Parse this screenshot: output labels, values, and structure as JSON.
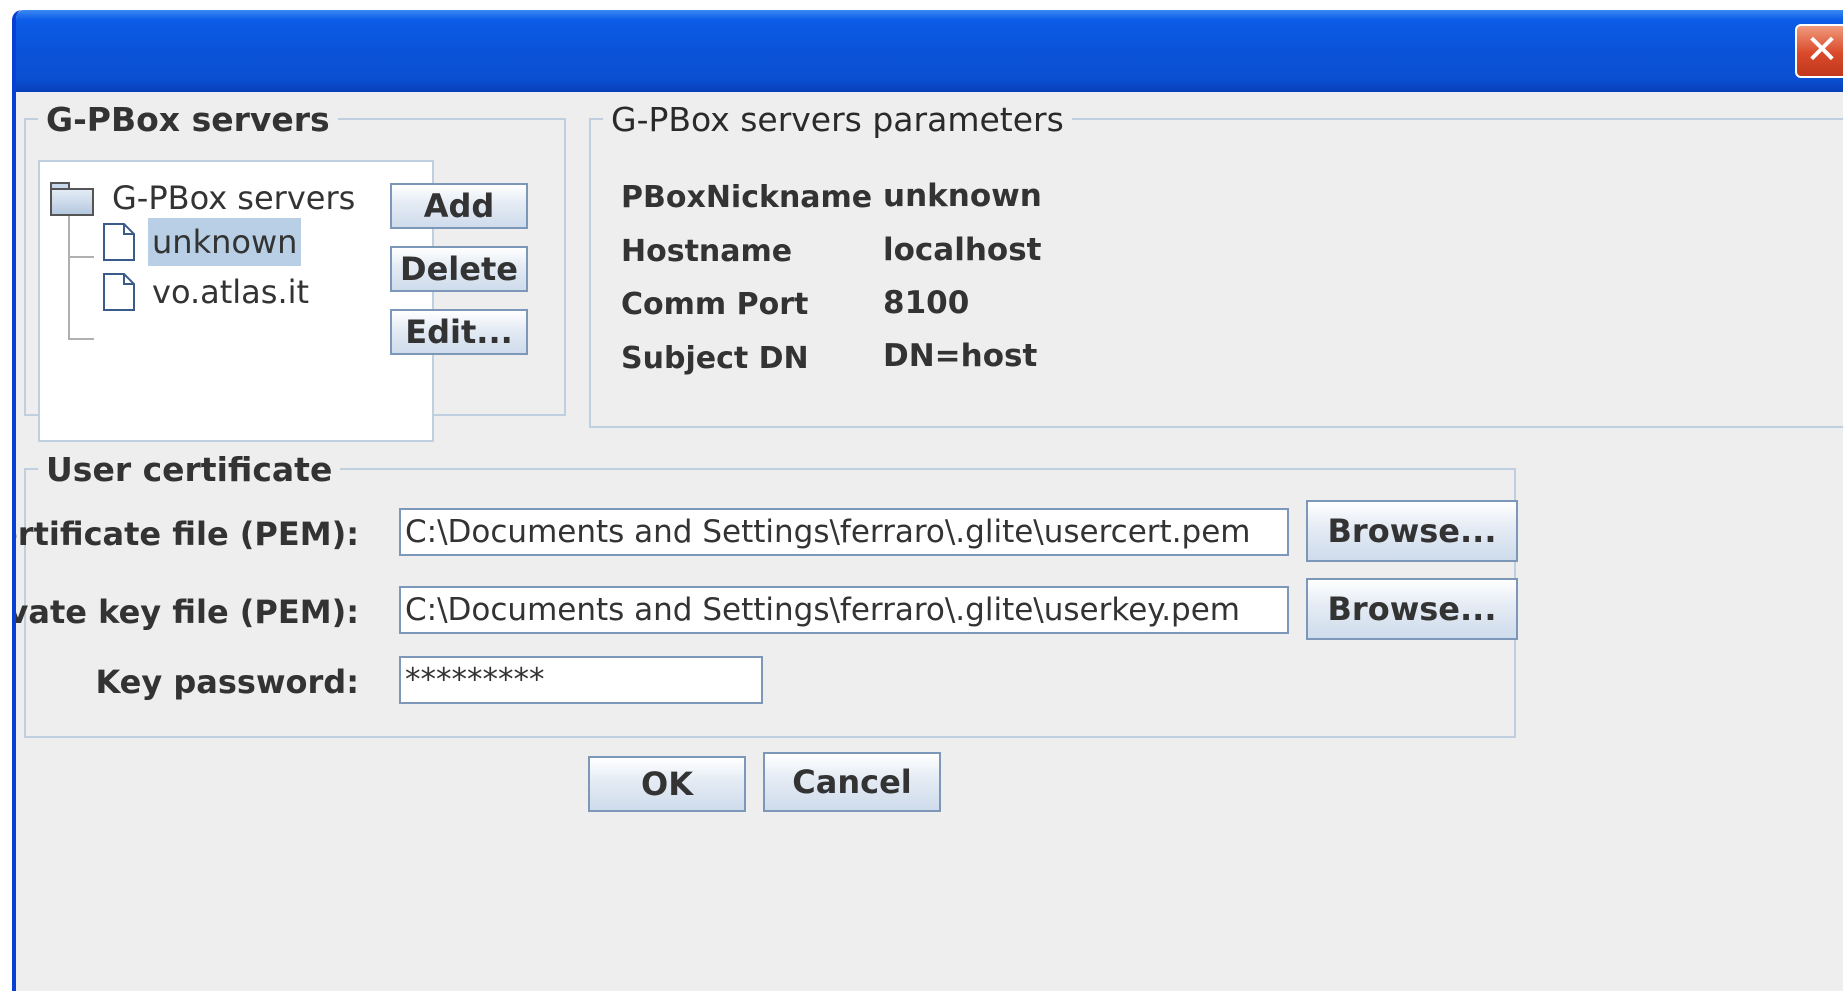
{
  "window": {
    "close_symbol": "✕"
  },
  "servers_panel": {
    "legend": "G-PBox servers",
    "tree": {
      "root_label": "G-PBox servers",
      "items": [
        {
          "label": "unknown",
          "selected": true
        },
        {
          "label": "vo.atlas.it",
          "selected": false
        }
      ]
    },
    "buttons": {
      "add": "Add",
      "delete": "Delete",
      "edit": "Edit..."
    }
  },
  "params_panel": {
    "legend": "G-PBox servers parameters",
    "rows": [
      {
        "label": "PBoxNickname",
        "value": "unknown"
      },
      {
        "label": "Hostname",
        "value": "localhost"
      },
      {
        "label": "Comm Port",
        "value": "8100"
      },
      {
        "label": "Subject DN",
        "value": "DN=host"
      }
    ]
  },
  "certificate_panel": {
    "legend": "User certificate",
    "certificate_file": {
      "label": "Certificate file (PEM):",
      "value": "C:\\Documents and Settings\\ferraro\\.glite\\usercert.pem",
      "browse_label": "Browse..."
    },
    "private_key_file": {
      "label": "Private key file (PEM):",
      "value": "C:\\Documents and Settings\\ferraro\\.glite\\userkey.pem",
      "browse_label": "Browse..."
    },
    "key_password": {
      "label": "Key password:",
      "value": "*********"
    }
  },
  "footer": {
    "ok": "OK",
    "cancel": "Cancel"
  },
  "colors": {
    "titlebar": "#0a53d8",
    "window_bg": "#eeeeee",
    "close_button": "#d9492a",
    "selection": "#b8cfe5",
    "panel_border": "#bfcfe0"
  },
  "icons": {
    "tree_root": "folder-icon",
    "tree_item": "document-icon",
    "close": "close-icon"
  }
}
